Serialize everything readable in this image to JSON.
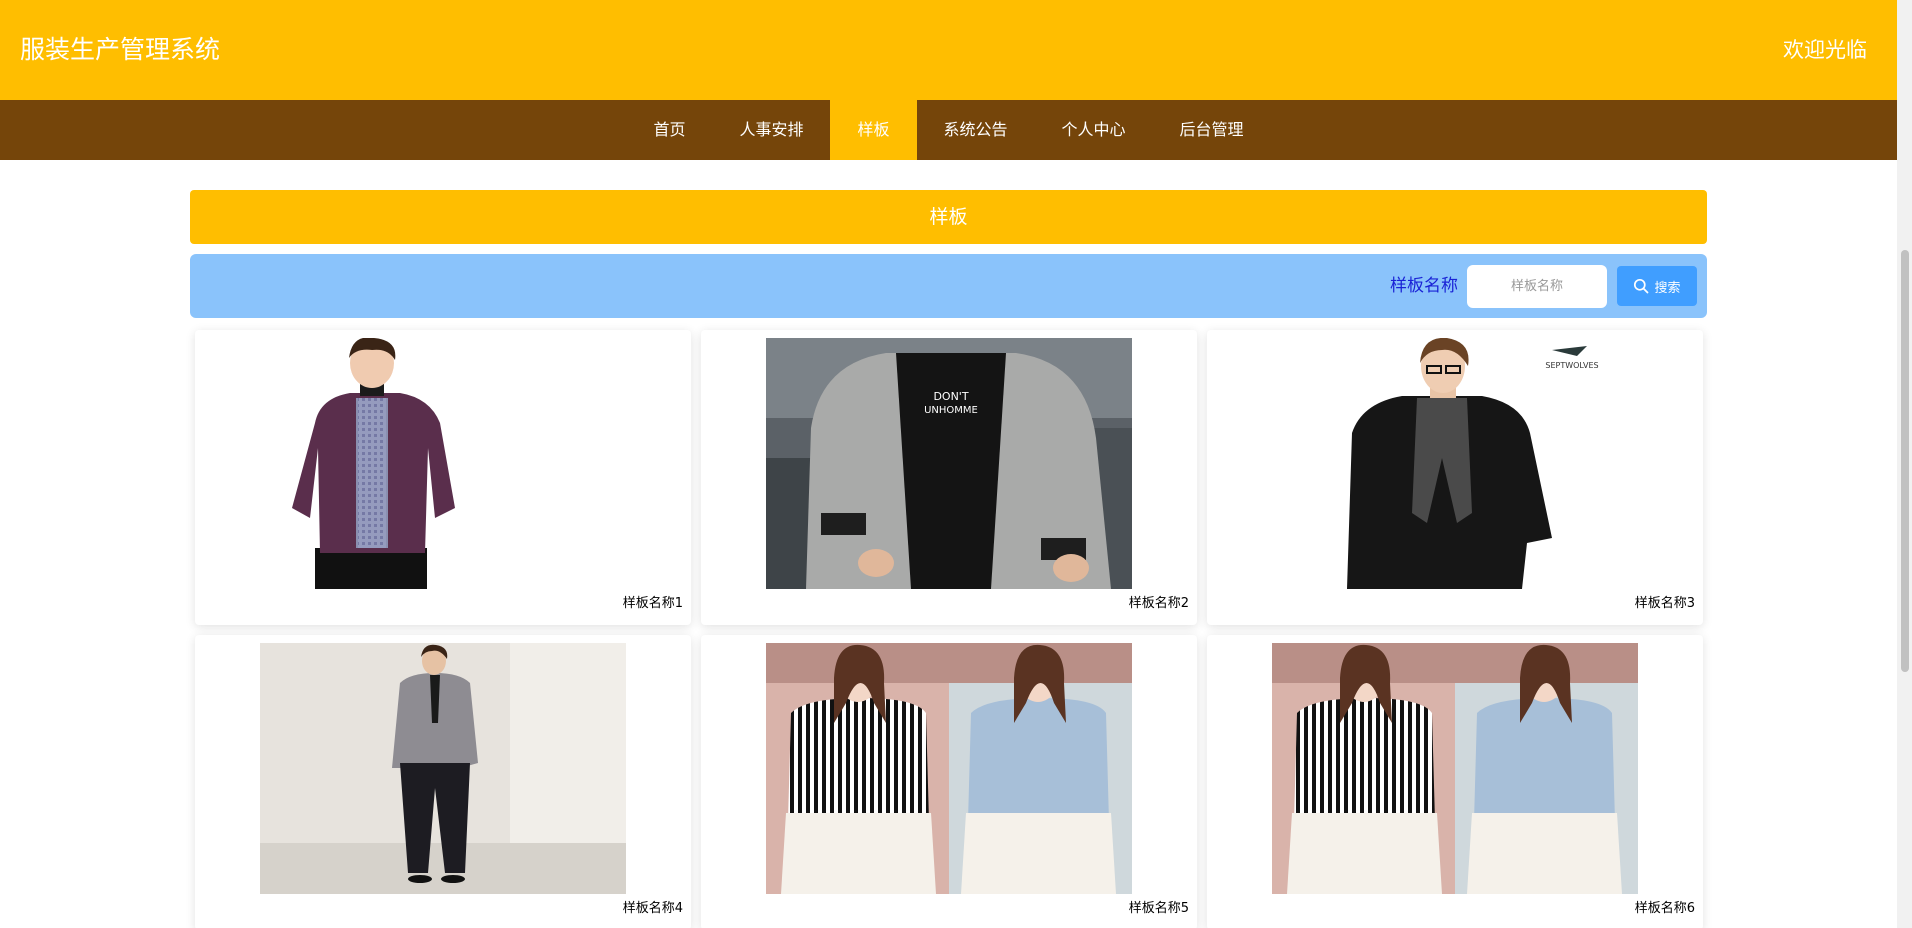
{
  "header": {
    "title": "服装生产管理系统",
    "welcome": "欢迎光临"
  },
  "nav": {
    "items": [
      {
        "label": "首页"
      },
      {
        "label": "人事安排"
      },
      {
        "label": "样板"
      },
      {
        "label": "系统公告"
      },
      {
        "label": "个人中心"
      },
      {
        "label": "后台管理"
      }
    ],
    "active_index": 2
  },
  "banner": {
    "title": "样板"
  },
  "search": {
    "label": "样板名称",
    "placeholder": "样板名称",
    "value": "",
    "button_label": "搜索",
    "button_icon": "search-icon"
  },
  "cards": [
    {
      "name": "样板名称1",
      "image": "man-purple-fleece-jacket-photo"
    },
    {
      "name": "样板名称2",
      "image": "man-grey-hooded-jacket-photo"
    },
    {
      "name": "样板名称3",
      "image": "man-black-jacket-scarf-photo"
    },
    {
      "name": "样板名称4",
      "image": "man-grey-blazer-photo"
    },
    {
      "name": "样板名称5",
      "image": "women-striped-lace-tops-photo"
    },
    {
      "name": "样板名称6",
      "image": "women-striped-lace-tops-photo"
    }
  ],
  "colors": {
    "header_bg": "#ffbe00",
    "nav_bg": "#75450a",
    "search_bar_bg": "#8ac3fb",
    "search_button_bg": "#409eff",
    "search_label": "#1a23d6"
  }
}
